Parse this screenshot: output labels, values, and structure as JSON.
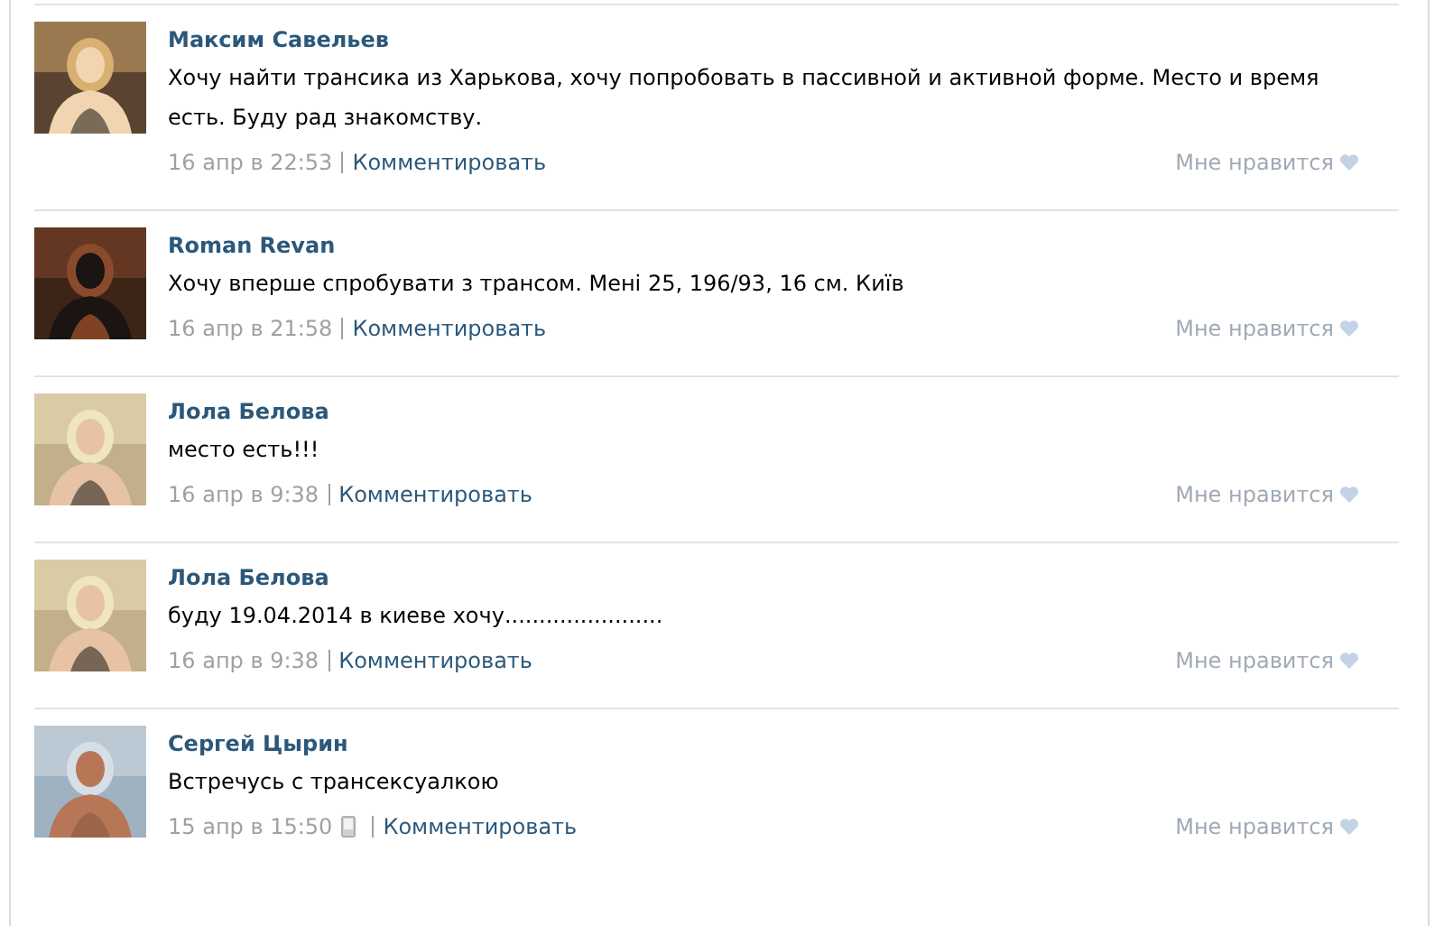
{
  "posts": [
    {
      "author": "Максим Савельев",
      "text": "Хочу найти трансика из Харькова, хочу попробовать в пассивной и активной форме. Место и время есть. Буду рад знакомству.",
      "date": "16 апр в 22:53",
      "mobile": false,
      "comment_link": "Комментировать",
      "like": "Мне нравится"
    },
    {
      "author": "Roman Revan",
      "text": "Хочу вперше спробувати з трансом. Мені 25, 196/93, 16 см. Київ",
      "date": "16 апр в 21:58",
      "mobile": false,
      "comment_link": "Комментировать",
      "like": "Мне нравится"
    },
    {
      "author": "Лола Белова",
      "text": "место есть!!!",
      "date": "16 апр в 9:38",
      "mobile": false,
      "comment_link": "Комментировать",
      "like": "Мне нравится"
    },
    {
      "author": "Лола Белова",
      "text": "буду 19.04.2014 в киеве хочу.......................",
      "date": "16 апр в 9:38",
      "mobile": false,
      "comment_link": "Комментировать",
      "like": "Мне нравится"
    },
    {
      "author": "Сергей Цырин",
      "text": "Встречусь с трансексуалкою",
      "date": "15 апр в 15:50",
      "mobile": true,
      "comment_link": "Комментировать",
      "like": "Мне нравится"
    }
  ]
}
